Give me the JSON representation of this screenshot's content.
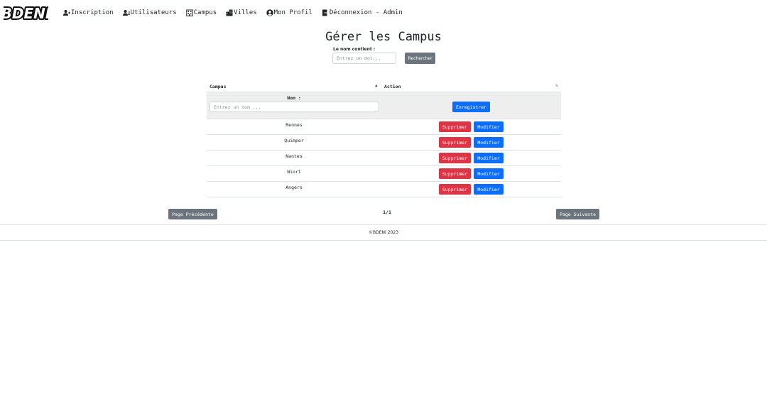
{
  "brand": {
    "logo_text": "BDENI"
  },
  "nav": {
    "items": [
      {
        "label": "Inscription",
        "icon": "user-plus-icon"
      },
      {
        "label": "Utilisateurs",
        "icon": "users-list-icon"
      },
      {
        "label": "Campus",
        "icon": "school-icon"
      },
      {
        "label": "Villes",
        "icon": "city-icon"
      },
      {
        "label": "Mon Profil",
        "icon": "user-circle-icon"
      },
      {
        "label": "Déconnexion - Admin",
        "icon": "logout-icon"
      }
    ]
  },
  "page": {
    "title": "Gérer les Campus"
  },
  "search": {
    "label": "Le nom contient :",
    "placeholder": "Entrez un mot...",
    "button": "Rechercher"
  },
  "table": {
    "headers": {
      "campus": "Campus",
      "action": "Action"
    },
    "add_row": {
      "label": "Nom :",
      "placeholder": "Entrez un nom ...",
      "save_label": "Enregistrer"
    },
    "rows": [
      {
        "name": "Rennes",
        "delete": "Supprimer",
        "edit": "Modifier"
      },
      {
        "name": "Quimper",
        "delete": "Supprimer",
        "edit": "Modifier"
      },
      {
        "name": "Nantes",
        "delete": "Supprimer",
        "edit": "Modifier"
      },
      {
        "name": "Niort",
        "delete": "Supprimer",
        "edit": "Modifier"
      },
      {
        "name": "Angers",
        "delete": "Supprimer",
        "edit": "Modifier"
      }
    ]
  },
  "pagination": {
    "prev": "Page Précédente",
    "next": "Page Suivante",
    "page": "1/1"
  },
  "footer": {
    "text": "©BDENI 2023"
  },
  "colors": {
    "primary": "#0d6efd",
    "danger": "#dc3545",
    "secondary": "#6c757d",
    "add_row_bg": "#eeeeee"
  }
}
